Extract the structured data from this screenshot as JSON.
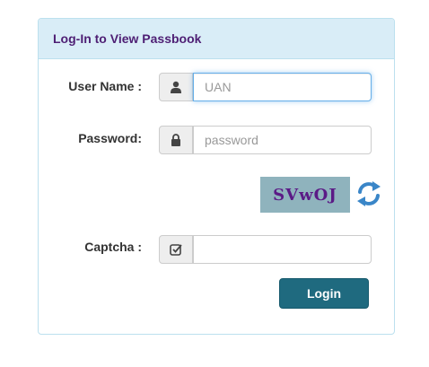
{
  "panel": {
    "title": "Log-In to View Passbook"
  },
  "username": {
    "label": "User Name :",
    "placeholder": "UAN",
    "value": "",
    "icon": "user-icon"
  },
  "password": {
    "label": "Password:",
    "placeholder": "password",
    "value": "",
    "icon": "lock-icon"
  },
  "captcha": {
    "image_text": "SVwOJ",
    "refresh_icon": "refresh-icon",
    "label": "Captcha :",
    "placeholder": "",
    "value": "",
    "icon": "check-square-icon"
  },
  "login_button": {
    "label": "Login"
  },
  "colors": {
    "heading_bg": "#d9edf7",
    "title": "#4e1f74",
    "button": "#1f6a7f",
    "captcha_bg": "#8fb3bd",
    "captcha_text": "#5b1a86",
    "refresh": "#3a86c8"
  }
}
